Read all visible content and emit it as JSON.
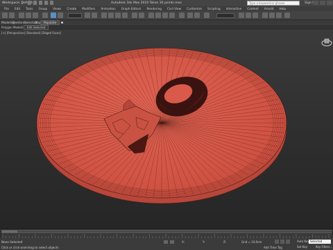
{
  "titlebar": {
    "workspace_label": "Workspace: Default",
    "app_title": "Autodesk 3ds Max 2019    Token 30 points.max",
    "search_placeholder": "Type a keyword or phrase",
    "signin_label": "Sign In"
  },
  "menubar": {
    "items": [
      "File",
      "Edit",
      "Tools",
      "Group",
      "Views",
      "Create",
      "Modifiers",
      "Animation",
      "Graph Editors",
      "Rendering",
      "Civil View",
      "Customize",
      "Scripting",
      "Interactive",
      "Content",
      "Arnold",
      "Help"
    ]
  },
  "ribbon": {
    "tabs": [
      "Modeling",
      "Freeform",
      "Selection",
      "Object Paint",
      "Populate"
    ]
  },
  "subribbon": {
    "tabs": [
      "Polygon Modeling",
      "Edit Selected"
    ]
  },
  "viewport": {
    "label": "[+] [Perspective] [Standard] [Edged Faces]",
    "model_color": "#d95a4a",
    "wire_color": "#4a1c16",
    "hole_color": "#3a1310"
  },
  "status": {
    "selection_text": "None Selected",
    "prompt_text": "Click or click-and-drag to select objects",
    "x_label": "X:",
    "y_label": "Y:",
    "z_label": "Z:",
    "grid_text": "Grid = 10,0cm",
    "add_time_tag": "Add Time Tag",
    "auto_key_label": "Auto Key",
    "selected_value": "Selected",
    "set_key_label": "Set Key",
    "key_filters_label": "Key Filters..."
  },
  "colors": {
    "accent": "#5a8fc7",
    "ui_bg": "#444444"
  }
}
